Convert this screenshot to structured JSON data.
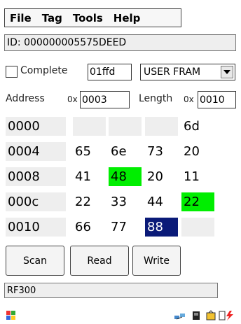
{
  "menu": [
    "File",
    "Tag",
    "Tools",
    "Help"
  ],
  "id_field": {
    "value": "ID: 000000005575DEED"
  },
  "complete": {
    "label": "Complete",
    "checked": false,
    "value": "01ffd"
  },
  "memory_select": {
    "selected": "USER FRAM"
  },
  "address": {
    "label": "Address",
    "prefix": "0x",
    "value": "0003"
  },
  "length": {
    "label": "Length",
    "prefix": "0x",
    "value": "0010"
  },
  "grid": {
    "rows": [
      {
        "addr": "0000",
        "cells": [
          "",
          "",
          "",
          "6d"
        ]
      },
      {
        "addr": "0004",
        "cells": [
          "65",
          "6e",
          "73",
          "20"
        ]
      },
      {
        "addr": "0008",
        "cells": [
          "41",
          "48",
          "20",
          "11"
        ]
      },
      {
        "addr": "000c",
        "cells": [
          "22",
          "33",
          "44",
          "22"
        ]
      },
      {
        "addr": "0010",
        "cells": [
          "66",
          "77",
          "88",
          ""
        ]
      }
    ],
    "colors": {
      "disabled": "#eeeeee",
      "normal": "#ffffff",
      "changed": "#00ee00",
      "selected": "#0a1a78"
    }
  },
  "buttons": {
    "scan": "Scan",
    "read": "Read",
    "write": "Write"
  },
  "status": {
    "text": "RF300"
  },
  "taskbar": {
    "icons": [
      "windows-start-icon",
      "network-icon",
      "battery-icon",
      "keyboard-icon",
      "flash-icon"
    ]
  }
}
